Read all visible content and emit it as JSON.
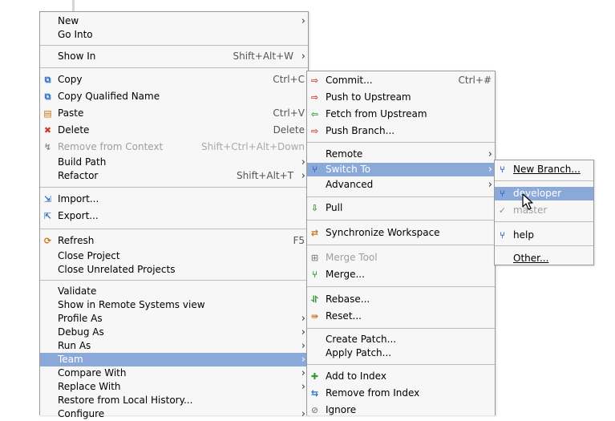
{
  "context_menu": {
    "items": [
      {
        "label": "New",
        "accel": "",
        "submenu": true,
        "icon": ""
      },
      {
        "label": "Go Into",
        "accel": "",
        "submenu": false,
        "icon": ""
      },
      {
        "label": "Show In",
        "accel": "Shift+Alt+W",
        "submenu": true,
        "icon": ""
      },
      {
        "label": "Copy",
        "accel": "Ctrl+C",
        "submenu": false,
        "icon": "copy-icon"
      },
      {
        "label": "Copy Qualified Name",
        "accel": "",
        "submenu": false,
        "icon": "copy-qualified-name-icon"
      },
      {
        "label": "Paste",
        "accel": "Ctrl+V",
        "submenu": false,
        "icon": "paste-icon"
      },
      {
        "label": "Delete",
        "accel": "Delete",
        "submenu": false,
        "icon": "delete-icon"
      },
      {
        "label": "Remove from Context",
        "accel": "Shift+Ctrl+Alt+Down",
        "submenu": false,
        "icon": "remove-context-icon",
        "disabled": true
      },
      {
        "label": "Build Path",
        "accel": "",
        "submenu": true,
        "icon": ""
      },
      {
        "label": "Refactor",
        "accel": "Shift+Alt+T",
        "submenu": true,
        "icon": ""
      },
      {
        "label": "Import...",
        "accel": "",
        "submenu": false,
        "icon": "import-icon"
      },
      {
        "label": "Export...",
        "accel": "",
        "submenu": false,
        "icon": "export-icon"
      },
      {
        "label": "Refresh",
        "accel": "F5",
        "submenu": false,
        "icon": "refresh-icon"
      },
      {
        "label": "Close Project",
        "accel": "",
        "submenu": false,
        "icon": ""
      },
      {
        "label": "Close Unrelated Projects",
        "accel": "",
        "submenu": false,
        "icon": ""
      },
      {
        "label": "Validate",
        "accel": "",
        "submenu": false,
        "icon": ""
      },
      {
        "label": "Show in Remote Systems view",
        "accel": "",
        "submenu": false,
        "icon": ""
      },
      {
        "label": "Profile As",
        "accel": "",
        "submenu": true,
        "icon": ""
      },
      {
        "label": "Debug As",
        "accel": "",
        "submenu": true,
        "icon": ""
      },
      {
        "label": "Run As",
        "accel": "",
        "submenu": true,
        "icon": ""
      },
      {
        "label": "Team",
        "accel": "",
        "submenu": true,
        "icon": "",
        "selected": true
      },
      {
        "label": "Compare With",
        "accel": "",
        "submenu": true,
        "icon": ""
      },
      {
        "label": "Replace With",
        "accel": "",
        "submenu": true,
        "icon": ""
      },
      {
        "label": "Restore from Local History...",
        "accel": "",
        "submenu": false,
        "icon": ""
      },
      {
        "label": "Configure",
        "accel": "",
        "submenu": true,
        "icon": ""
      }
    ]
  },
  "team_menu": {
    "items": [
      {
        "label": "Commit...",
        "accel": "Ctrl+#",
        "submenu": false,
        "icon": "commit-icon"
      },
      {
        "label": "Push to Upstream",
        "accel": "",
        "submenu": false,
        "icon": "push-upstream-icon"
      },
      {
        "label": "Fetch from Upstream",
        "accel": "",
        "submenu": false,
        "icon": "fetch-upstream-icon"
      },
      {
        "label": "Push Branch...",
        "accel": "",
        "submenu": false,
        "icon": "push-branch-icon"
      },
      {
        "label": "Remote",
        "accel": "",
        "submenu": true,
        "icon": ""
      },
      {
        "label": "Switch To",
        "accel": "",
        "submenu": true,
        "icon": "switch-to-icon",
        "selected": true
      },
      {
        "label": "Advanced",
        "accel": "",
        "submenu": true,
        "icon": ""
      },
      {
        "label": "Pull",
        "accel": "",
        "submenu": false,
        "icon": "pull-icon"
      },
      {
        "label": "Synchronize Workspace",
        "accel": "",
        "submenu": false,
        "icon": "synchronize-icon"
      },
      {
        "label": "Merge Tool",
        "accel": "",
        "submenu": false,
        "icon": "merge-tool-icon",
        "disabled": true
      },
      {
        "label": "Merge...",
        "accel": "",
        "submenu": false,
        "icon": "merge-icon"
      },
      {
        "label": "Rebase...",
        "accel": "",
        "submenu": false,
        "icon": "rebase-icon"
      },
      {
        "label": "Reset...",
        "accel": "",
        "submenu": false,
        "icon": "reset-icon"
      },
      {
        "label": "Create Patch...",
        "accel": "",
        "submenu": false,
        "icon": ""
      },
      {
        "label": "Apply Patch...",
        "accel": "",
        "submenu": false,
        "icon": ""
      },
      {
        "label": "Add to Index",
        "accel": "",
        "submenu": false,
        "icon": "add-to-index-icon"
      },
      {
        "label": "Remove from Index",
        "accel": "",
        "submenu": false,
        "icon": "remove-from-index-icon"
      },
      {
        "label": "Ignore",
        "accel": "",
        "submenu": false,
        "icon": "ignore-icon"
      }
    ]
  },
  "switch_menu": {
    "items": [
      {
        "label": "New Branch...",
        "submenu": false,
        "icon": "new-branch-icon"
      },
      {
        "label": "developer",
        "submenu": false,
        "icon": "branch-icon",
        "selected": true
      },
      {
        "label": "master",
        "submenu": false,
        "icon": "checked-branch-icon",
        "disabled": true
      },
      {
        "label": "help",
        "submenu": false,
        "icon": "branch-icon"
      },
      {
        "label": "Other...",
        "submenu": false,
        "icon": ""
      }
    ]
  },
  "colors": {
    "menu_bg": "#f7f7f7",
    "selection": "#8aa9d9",
    "disabled_text": "#9e9e9e",
    "separator": "#bdbdbd"
  }
}
